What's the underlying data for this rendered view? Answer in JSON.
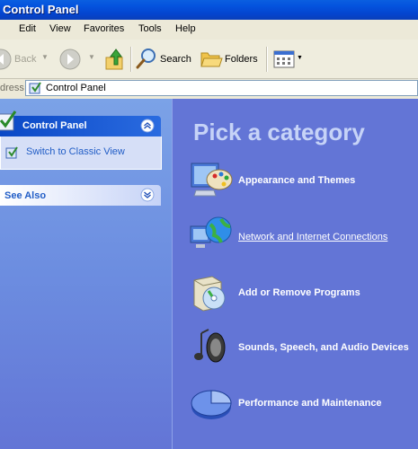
{
  "window": {
    "title": "Control Panel"
  },
  "menu": [
    "Edit",
    "View",
    "Favorites",
    "Tools",
    "Help"
  ],
  "toolbar": {
    "back_label": "Back",
    "search_label": "Search",
    "folders_label": "Folders"
  },
  "address": {
    "label": "dress",
    "value": "Control Panel"
  },
  "left_panel": {
    "control_panel_title": "Control Panel",
    "switch_view_label": "Switch to Classic View",
    "see_also_title": "See Also"
  },
  "main": {
    "heading": "Pick a category",
    "categories": [
      {
        "label": "Appearance and Themes",
        "icon": "appearance-themes-icon"
      },
      {
        "label": "Network and Internet Connections",
        "icon": "network-globe-icon"
      },
      {
        "label": "Add or Remove Programs",
        "icon": "add-remove-programs-icon"
      },
      {
        "label": "Sounds, Speech, and Audio Devices",
        "icon": "speaker-music-icon"
      },
      {
        "label": "Performance and Maintenance",
        "icon": "pie-chart-icon"
      }
    ]
  },
  "colors": {
    "titlebar": "#0453de",
    "left_gradient_top": "#7ba2e7",
    "content_bg": "#6375d6",
    "heading": "#c6d3f7",
    "task_header": "#215dc6"
  }
}
